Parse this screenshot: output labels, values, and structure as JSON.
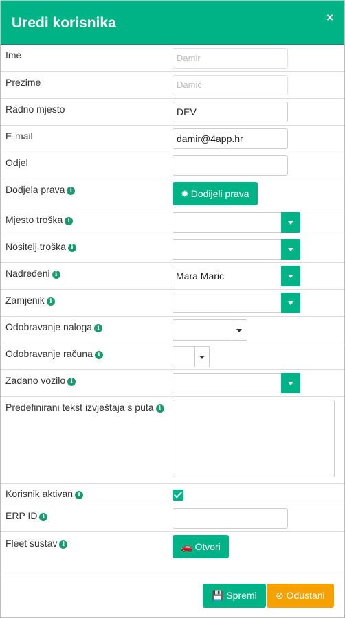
{
  "dialog": {
    "title": "Uredi korisnika",
    "close_glyph": "×"
  },
  "fields": {
    "ime": {
      "label": "Ime",
      "value": "Damir"
    },
    "prezime": {
      "label": "Prezime",
      "value": "Damić"
    },
    "radno_mjesto": {
      "label": "Radno mjesto",
      "value": "DEV"
    },
    "email": {
      "label": "E-mail",
      "value": "damir@4app.hr"
    },
    "odjel": {
      "label": "Odjel",
      "value": ""
    },
    "dodjela_prava": {
      "label": "Dodjela prava",
      "button": "Dodijeli prava"
    },
    "mjesto_troska": {
      "label": "Mjesto troška",
      "value": ""
    },
    "nositelj_troska": {
      "label": "Nositelj troška",
      "value": ""
    },
    "nadredjeni": {
      "label": "Nadređeni",
      "value": "Mara Maric"
    },
    "zamjenik": {
      "label": "Zamjenik",
      "value": ""
    },
    "odobravanje_naloga": {
      "label": "Odobravanje naloga",
      "value": ""
    },
    "odobravanje_racuna": {
      "label": "Odobravanje računa",
      "value": ""
    },
    "zadano_vozilo": {
      "label": "Zadano vozilo",
      "value": ""
    },
    "predefinirani_tekst": {
      "label": "Predefinirani tekst izvještaja s puta",
      "value": ""
    },
    "korisnik_aktivan": {
      "label": "Korisnik aktivan",
      "checked": true
    },
    "erp_id": {
      "label": "ERP ID",
      "value": ""
    },
    "fleet_sustav": {
      "label": "Fleet sustav",
      "button": "Otvori"
    }
  },
  "footer": {
    "save_label": "Spremi",
    "cancel_label": "Odustani"
  },
  "icons": {
    "info": "info-circle-icon",
    "gear": "gear-icon",
    "car": "car-icon",
    "save": "floppy-disk-icon",
    "cancel": "ban-circle-icon"
  },
  "colors": {
    "accent": "#00b386",
    "warning": "#f5a100"
  }
}
